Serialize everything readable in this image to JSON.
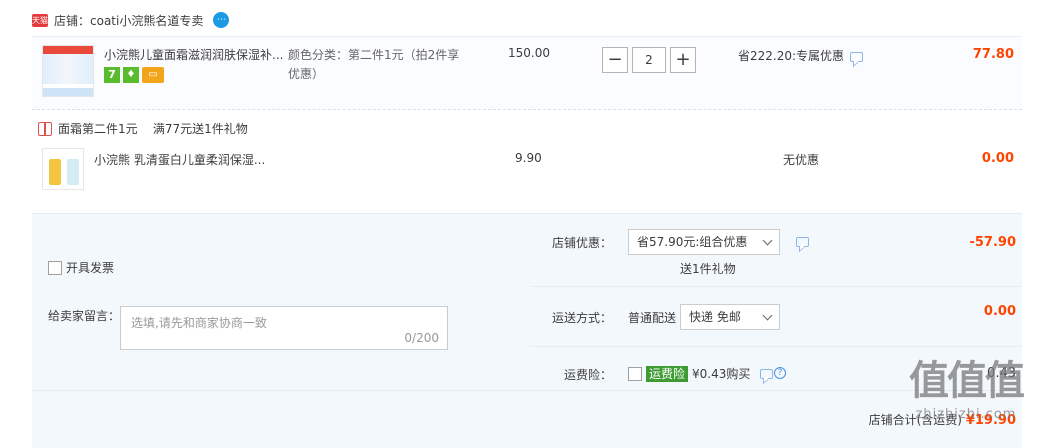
{
  "shop": {
    "badge": "天猫",
    "name": "店铺：coati小浣熊名道专卖",
    "chat_icon": "ww-icon"
  },
  "item1": {
    "title": "小浣熊儿童面霜滋润润肤保湿补...",
    "sku": "颜色分类：第二件1元（拍2件享优惠）",
    "price": "150.00",
    "qty": "2",
    "qty_minus": "−",
    "qty_plus": "+",
    "discount": "省222.20:专属优惠",
    "total": "77.80",
    "badge_seven": "7"
  },
  "promo": {
    "text": "面霜第二件1元    满77元送1件礼物"
  },
  "item2": {
    "title": "小浣熊 乳清蛋白儿童柔润保湿...",
    "price": "9.90",
    "discount": "无优惠",
    "total": "0.00"
  },
  "footer": {
    "invoice_label": "开具发票",
    "note_label": "给卖家留言：",
    "note_placeholder": "选填,请先和商家协商一致",
    "note_count": "0/200",
    "shop_discount_label": "店铺优惠：",
    "shop_discount_value": "省57.90元:组合优惠",
    "shop_discount_amount": "-57.90",
    "gift_note": "送1件礼物",
    "shipping_label": "运送方式：",
    "shipping_type": "普通配送",
    "shipping_value": "快递 免邮",
    "shipping_amount": "0.00",
    "insurance_label": "运费险：",
    "insurance_tag": "运费险",
    "insurance_price": "¥0.43购买",
    "insurance_amount": "0.43",
    "sum_label": "店铺合计(含运费)",
    "sum_value": "¥19.90"
  },
  "watermark": {
    "top": "值值值",
    "bottom": "zhizhizhi.com"
  }
}
